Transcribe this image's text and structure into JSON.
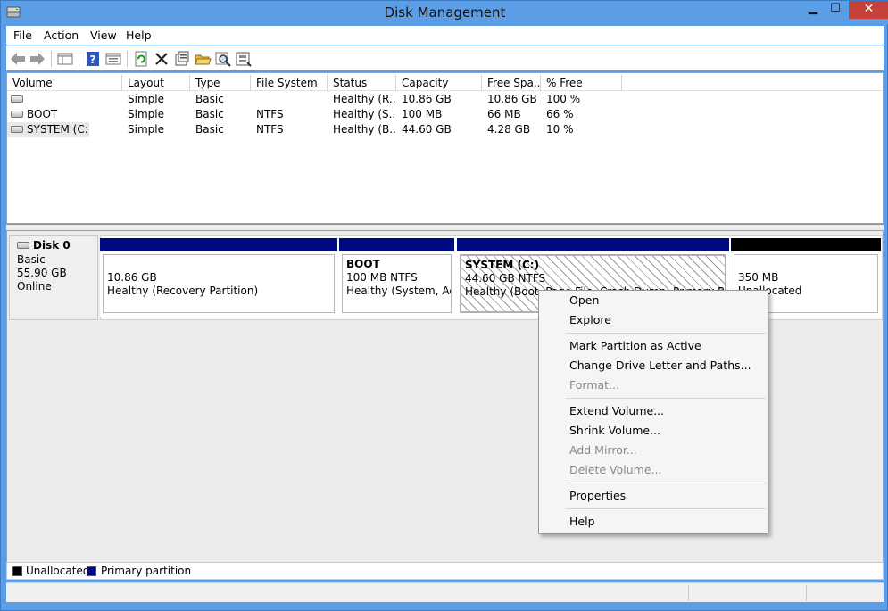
{
  "window": {
    "title": "Disk Management",
    "minimize": "▁",
    "maximize": "☐",
    "close": "✕"
  },
  "menubar": [
    "File",
    "Action",
    "View",
    "Help"
  ],
  "toolbar": [
    {
      "icon": "back-arrow-icon"
    },
    {
      "icon": "forward-arrow-icon"
    },
    {
      "icon": "show-hide-console-tree-icon"
    },
    {
      "icon": "help-icon"
    },
    {
      "icon": "properties-icon"
    },
    {
      "icon": "refresh-icon"
    },
    {
      "icon": "delete-icon"
    },
    {
      "icon": "properties-icon"
    },
    {
      "icon": "open-folder-icon"
    },
    {
      "icon": "magnifier-icon"
    },
    {
      "icon": "rescan-disks-icon"
    }
  ],
  "volume_list": {
    "columns": [
      "Volume",
      "Layout",
      "Type",
      "File System",
      "Status",
      "Capacity",
      "Free Spa...",
      "% Free"
    ],
    "rows": [
      {
        "volume": "",
        "layout": "Simple",
        "type": "Basic",
        "fs": "",
        "status": "Healthy (R...",
        "capacity": "10.86 GB",
        "free": "10.86 GB",
        "pct": "100 %"
      },
      {
        "volume": "BOOT",
        "layout": "Simple",
        "type": "Basic",
        "fs": "NTFS",
        "status": "Healthy (S...",
        "capacity": "100 MB",
        "free": "66 MB",
        "pct": "66 %"
      },
      {
        "volume": "SYSTEM (C:)",
        "layout": "Simple",
        "type": "Basic",
        "fs": "NTFS",
        "status": "Healthy (B...",
        "capacity": "44.60 GB",
        "free": "4.28 GB",
        "pct": "10 %"
      }
    ]
  },
  "disk": {
    "name": "Disk 0",
    "type": "Basic",
    "size": "55.90 GB",
    "state": "Online"
  },
  "partitions": [
    {
      "name": "",
      "size": "10.86 GB",
      "status": "Healthy (Recovery Partition)",
      "bar": "#000a80"
    },
    {
      "name": "BOOT",
      "size": "100 MB NTFS",
      "status": "Healthy (System, Active, Primary Partition)",
      "bar": "#000a80"
    },
    {
      "name": "SYSTEM  (C:)",
      "size": "44.60 GB NTFS",
      "status": "Healthy (Boot, Page File, Crash Dump, Primary Partition)",
      "bar": "#000a80"
    },
    {
      "name": "",
      "size": "350 MB",
      "status": "Unallocated",
      "bar": "#000000"
    }
  ],
  "legend": [
    {
      "label": "Unallocated",
      "color": "#000000"
    },
    {
      "label": "Primary partition",
      "color": "#000a80"
    }
  ],
  "context_menu": {
    "items": [
      "Open",
      "Explore",
      "Mark Partition as Active",
      "Change Drive Letter and Paths...",
      "Format...",
      "Extend Volume...",
      "Shrink Volume...",
      "Add Mirror...",
      "Delete Volume...",
      "Properties",
      "Help"
    ],
    "disabled": [
      "Format...",
      "Add Mirror...",
      "Delete Volume..."
    ]
  }
}
